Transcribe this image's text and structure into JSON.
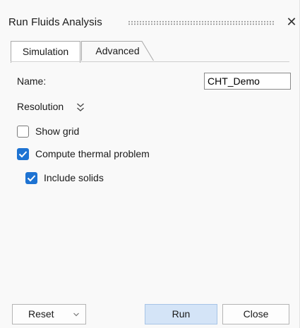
{
  "window": {
    "title": "Run Fluids Analysis"
  },
  "tabs": [
    {
      "label": "Simulation",
      "active": true
    },
    {
      "label": "Advanced",
      "active": false
    }
  ],
  "form": {
    "name_label": "Name:",
    "name_value": "CHT_Demo",
    "resolution_label": "Resolution",
    "show_grid": {
      "label": "Show grid",
      "checked": false
    },
    "compute_thermal": {
      "label": "Compute thermal problem",
      "checked": true
    },
    "include_solids": {
      "label": "Include solids",
      "checked": true
    }
  },
  "buttons": {
    "reset": "Reset",
    "run": "Run",
    "close": "Close"
  },
  "colors": {
    "accent": "#1e73d2",
    "run_button": "#d4e4f7"
  }
}
